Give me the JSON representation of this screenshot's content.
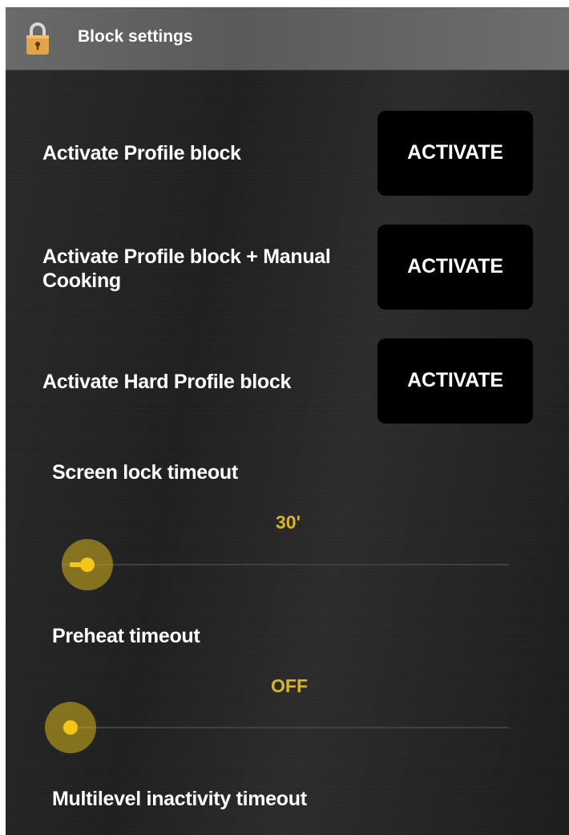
{
  "titlebar": {
    "title": "Block settings",
    "icon": "lock-icon"
  },
  "blocks": [
    {
      "label": "Activate Profile block",
      "button": "ACTIVATE"
    },
    {
      "label": "Activate Profile block + Manual Cooking",
      "button": "ACTIVATE"
    },
    {
      "label": "Activate Hard Profile block",
      "button": "ACTIVATE"
    }
  ],
  "screen_lock": {
    "label": "Screen lock timeout",
    "value": "30'",
    "level": 0.05
  },
  "preheat": {
    "label": "Preheat timeout",
    "value": "OFF",
    "level": 0.0
  },
  "multilevel": {
    "label": "Multilevel inactivity timeout"
  },
  "colors": {
    "accent": "#d9b42a",
    "button_bg": "#000000",
    "titlebar_bg": "#666666"
  }
}
